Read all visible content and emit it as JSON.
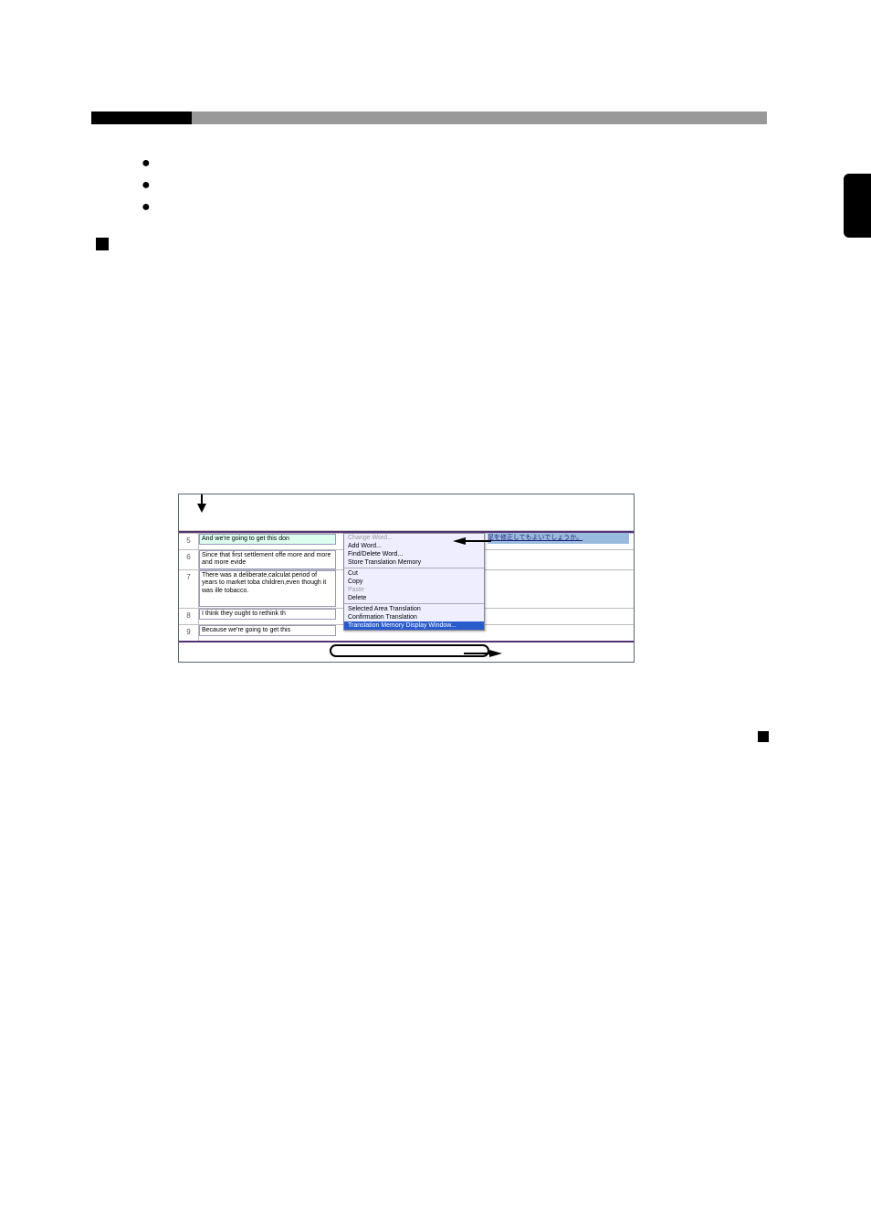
{
  "bullets": {
    "b1": "",
    "b2": "",
    "b3": ""
  },
  "table": {
    "rows": [
      {
        "num": "5",
        "text": "And we're going to get this don"
      },
      {
        "num": "6",
        "text": "Since that first settlement offe more and more and more evide"
      },
      {
        "num": "7",
        "text": "There was a deliberate,calculat period of years to market toba children,even though it was ille tobacco."
      },
      {
        "num": "8",
        "text": "I think they ought to rethink th"
      },
      {
        "num": "9",
        "text": "Because we're going to get this"
      }
    ]
  },
  "context_menu": {
    "change_word": "Change Word...",
    "add_word": "Add Word...",
    "find_delete": "Find/Delete Word...",
    "store_tm": "Store Translation Memory",
    "cut": "Cut",
    "copy": "Copy",
    "paste": "Paste",
    "delete": "Delete",
    "selected_area": "Selected Area Translation",
    "confirmation": "Confirmation Translation",
    "tm_window": "Translation Memory Display Window..."
  },
  "right_snippet": "足を修正してもよいでしょうか。"
}
